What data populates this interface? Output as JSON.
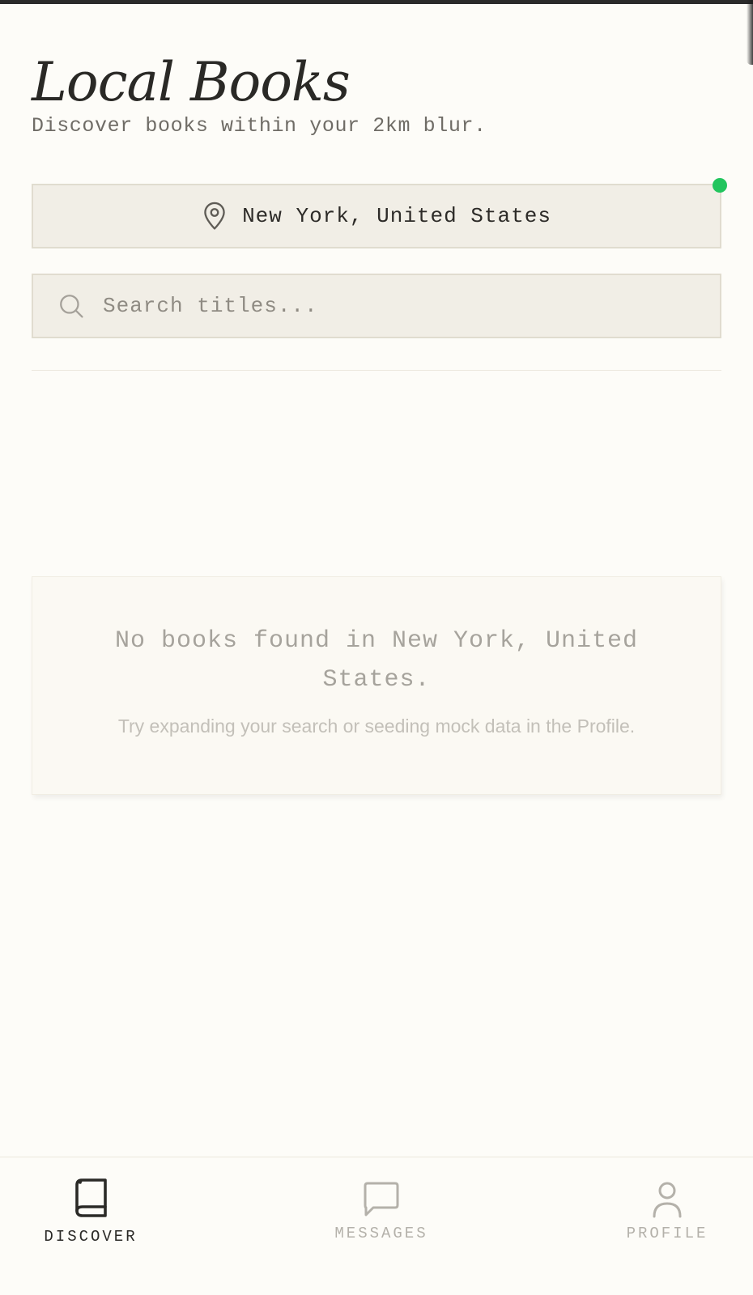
{
  "header": {
    "title": "Local Books",
    "subtitle": "Discover books within your 2km blur."
  },
  "location": {
    "label": "New York, United States",
    "icon": "map-pin-icon",
    "status_color": "#22c55e"
  },
  "search": {
    "placeholder": "Search titles...",
    "value": "",
    "icon": "search-icon"
  },
  "empty_state": {
    "title": "No books found in New York, United States.",
    "hint": "Try expanding your search or seeding mock data in the Profile."
  },
  "nav": {
    "items": [
      {
        "label": "DISCOVER",
        "icon": "book-icon",
        "active": true
      },
      {
        "label": "MESSAGES",
        "icon": "message-icon",
        "active": false
      },
      {
        "label": "PROFILE",
        "icon": "user-icon",
        "active": false
      }
    ]
  },
  "colors": {
    "background": "#fdfcf8",
    "field_background": "#f1eee6",
    "active_text": "#2b2a27",
    "inactive_text": "#b4b1aa",
    "accent_green": "#22c55e"
  }
}
